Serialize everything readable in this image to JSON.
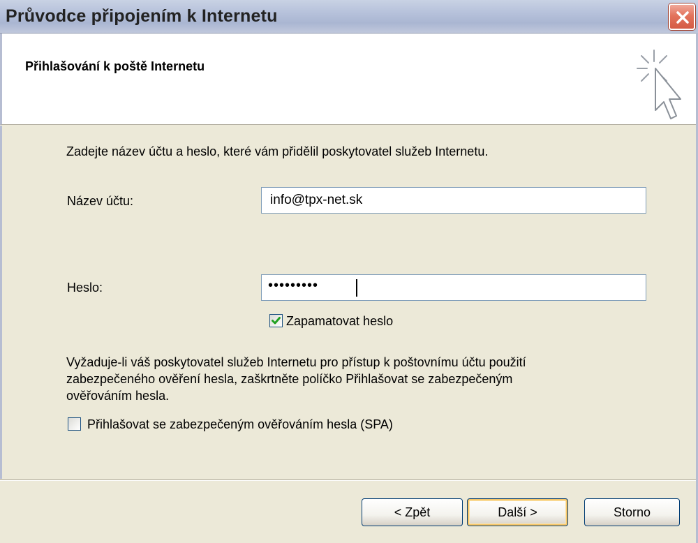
{
  "window": {
    "title": "Průvodce připojením k Internetu"
  },
  "header": {
    "heading": "Přihlašování k poště Internetu",
    "icon": "wizard-cursor-icon"
  },
  "form": {
    "intro": "Zadejte název účtu a heslo, které vám přidělil poskytovatel služeb Internetu.",
    "account_label": "Název účtu:",
    "account_value": "info@tpx-net.sk",
    "password_label": "Heslo:",
    "password_value": "•••••••••",
    "remember_label": "Zapamatovat heslo",
    "remember_checked": true,
    "spa_note_line1": "Vyžaduje-li váš poskytovatel služeb Internetu pro přístup k poštovnímu účtu použití",
    "spa_note_line2": "zabezpečeného ověření hesla, zaškrtněte políčko Přihlašovat se zabezpečeným",
    "spa_note_line3": "ověřováním hesla.",
    "spa_label": "Přihlašovat se zabezpečeným ověřováním hesla (SPA)",
    "spa_checked": false
  },
  "buttons": {
    "back": "< Zpět",
    "next": "Další >",
    "cancel": "Storno"
  },
  "colors": {
    "check_mark": "#21a121",
    "close_button": "#d45b45",
    "dialog_background": "#ece9d8"
  }
}
